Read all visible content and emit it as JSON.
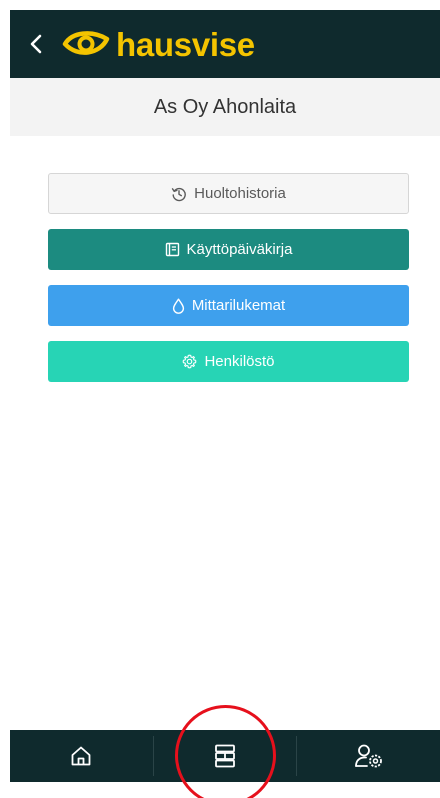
{
  "header": {
    "brand_name": "hausvise",
    "back_icon": "chevron-left-icon",
    "logo_icon": "eye-logo-icon",
    "brand_color": "#f4c400",
    "bar_color": "#0f2a2d"
  },
  "subheader": {
    "title": "As Oy Ahonlaita"
  },
  "menu": {
    "items": [
      {
        "label": "Huoltohistoria",
        "icon": "history-icon",
        "color": "#f6f6f6"
      },
      {
        "label": "Käyttöpäiväkirja",
        "icon": "notebook-icon",
        "color": "#1c8b80"
      },
      {
        "label": "Mittarilukemat",
        "icon": "droplet-icon",
        "color": "#3ea0ed"
      },
      {
        "label": "Henkilöstö",
        "icon": "gear-icon",
        "color": "#27d4b5"
      }
    ]
  },
  "bottom_nav": {
    "items": [
      {
        "icon": "home-icon"
      },
      {
        "icon": "server-icon",
        "highlighted": true
      },
      {
        "icon": "user-settings-icon"
      }
    ],
    "highlight_color": "#e6101c"
  }
}
